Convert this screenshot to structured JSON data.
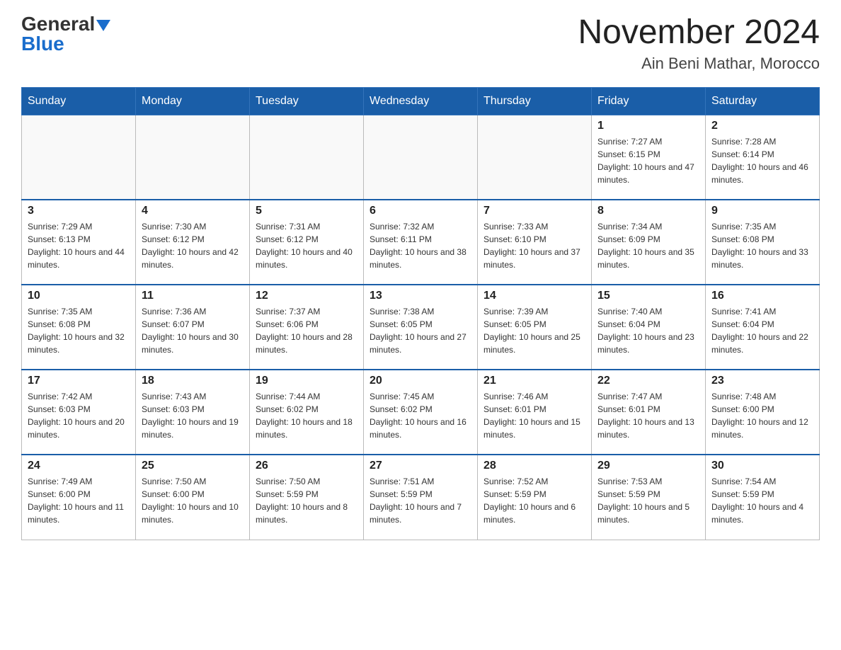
{
  "header": {
    "logo_general": "General",
    "logo_blue": "Blue",
    "title": "November 2024",
    "subtitle": "Ain Beni Mathar, Morocco"
  },
  "days_of_week": [
    "Sunday",
    "Monday",
    "Tuesday",
    "Wednesday",
    "Thursday",
    "Friday",
    "Saturday"
  ],
  "weeks": [
    [
      {
        "day": "",
        "sunrise": "",
        "sunset": "",
        "daylight": ""
      },
      {
        "day": "",
        "sunrise": "",
        "sunset": "",
        "daylight": ""
      },
      {
        "day": "",
        "sunrise": "",
        "sunset": "",
        "daylight": ""
      },
      {
        "day": "",
        "sunrise": "",
        "sunset": "",
        "daylight": ""
      },
      {
        "day": "",
        "sunrise": "",
        "sunset": "",
        "daylight": ""
      },
      {
        "day": "1",
        "sunrise": "Sunrise: 7:27 AM",
        "sunset": "Sunset: 6:15 PM",
        "daylight": "Daylight: 10 hours and 47 minutes."
      },
      {
        "day": "2",
        "sunrise": "Sunrise: 7:28 AM",
        "sunset": "Sunset: 6:14 PM",
        "daylight": "Daylight: 10 hours and 46 minutes."
      }
    ],
    [
      {
        "day": "3",
        "sunrise": "Sunrise: 7:29 AM",
        "sunset": "Sunset: 6:13 PM",
        "daylight": "Daylight: 10 hours and 44 minutes."
      },
      {
        "day": "4",
        "sunrise": "Sunrise: 7:30 AM",
        "sunset": "Sunset: 6:12 PM",
        "daylight": "Daylight: 10 hours and 42 minutes."
      },
      {
        "day": "5",
        "sunrise": "Sunrise: 7:31 AM",
        "sunset": "Sunset: 6:12 PM",
        "daylight": "Daylight: 10 hours and 40 minutes."
      },
      {
        "day": "6",
        "sunrise": "Sunrise: 7:32 AM",
        "sunset": "Sunset: 6:11 PM",
        "daylight": "Daylight: 10 hours and 38 minutes."
      },
      {
        "day": "7",
        "sunrise": "Sunrise: 7:33 AM",
        "sunset": "Sunset: 6:10 PM",
        "daylight": "Daylight: 10 hours and 37 minutes."
      },
      {
        "day": "8",
        "sunrise": "Sunrise: 7:34 AM",
        "sunset": "Sunset: 6:09 PM",
        "daylight": "Daylight: 10 hours and 35 minutes."
      },
      {
        "day": "9",
        "sunrise": "Sunrise: 7:35 AM",
        "sunset": "Sunset: 6:08 PM",
        "daylight": "Daylight: 10 hours and 33 minutes."
      }
    ],
    [
      {
        "day": "10",
        "sunrise": "Sunrise: 7:35 AM",
        "sunset": "Sunset: 6:08 PM",
        "daylight": "Daylight: 10 hours and 32 minutes."
      },
      {
        "day": "11",
        "sunrise": "Sunrise: 7:36 AM",
        "sunset": "Sunset: 6:07 PM",
        "daylight": "Daylight: 10 hours and 30 minutes."
      },
      {
        "day": "12",
        "sunrise": "Sunrise: 7:37 AM",
        "sunset": "Sunset: 6:06 PM",
        "daylight": "Daylight: 10 hours and 28 minutes."
      },
      {
        "day": "13",
        "sunrise": "Sunrise: 7:38 AM",
        "sunset": "Sunset: 6:05 PM",
        "daylight": "Daylight: 10 hours and 27 minutes."
      },
      {
        "day": "14",
        "sunrise": "Sunrise: 7:39 AM",
        "sunset": "Sunset: 6:05 PM",
        "daylight": "Daylight: 10 hours and 25 minutes."
      },
      {
        "day": "15",
        "sunrise": "Sunrise: 7:40 AM",
        "sunset": "Sunset: 6:04 PM",
        "daylight": "Daylight: 10 hours and 23 minutes."
      },
      {
        "day": "16",
        "sunrise": "Sunrise: 7:41 AM",
        "sunset": "Sunset: 6:04 PM",
        "daylight": "Daylight: 10 hours and 22 minutes."
      }
    ],
    [
      {
        "day": "17",
        "sunrise": "Sunrise: 7:42 AM",
        "sunset": "Sunset: 6:03 PM",
        "daylight": "Daylight: 10 hours and 20 minutes."
      },
      {
        "day": "18",
        "sunrise": "Sunrise: 7:43 AM",
        "sunset": "Sunset: 6:03 PM",
        "daylight": "Daylight: 10 hours and 19 minutes."
      },
      {
        "day": "19",
        "sunrise": "Sunrise: 7:44 AM",
        "sunset": "Sunset: 6:02 PM",
        "daylight": "Daylight: 10 hours and 18 minutes."
      },
      {
        "day": "20",
        "sunrise": "Sunrise: 7:45 AM",
        "sunset": "Sunset: 6:02 PM",
        "daylight": "Daylight: 10 hours and 16 minutes."
      },
      {
        "day": "21",
        "sunrise": "Sunrise: 7:46 AM",
        "sunset": "Sunset: 6:01 PM",
        "daylight": "Daylight: 10 hours and 15 minutes."
      },
      {
        "day": "22",
        "sunrise": "Sunrise: 7:47 AM",
        "sunset": "Sunset: 6:01 PM",
        "daylight": "Daylight: 10 hours and 13 minutes."
      },
      {
        "day": "23",
        "sunrise": "Sunrise: 7:48 AM",
        "sunset": "Sunset: 6:00 PM",
        "daylight": "Daylight: 10 hours and 12 minutes."
      }
    ],
    [
      {
        "day": "24",
        "sunrise": "Sunrise: 7:49 AM",
        "sunset": "Sunset: 6:00 PM",
        "daylight": "Daylight: 10 hours and 11 minutes."
      },
      {
        "day": "25",
        "sunrise": "Sunrise: 7:50 AM",
        "sunset": "Sunset: 6:00 PM",
        "daylight": "Daylight: 10 hours and 10 minutes."
      },
      {
        "day": "26",
        "sunrise": "Sunrise: 7:50 AM",
        "sunset": "Sunset: 5:59 PM",
        "daylight": "Daylight: 10 hours and 8 minutes."
      },
      {
        "day": "27",
        "sunrise": "Sunrise: 7:51 AM",
        "sunset": "Sunset: 5:59 PM",
        "daylight": "Daylight: 10 hours and 7 minutes."
      },
      {
        "day": "28",
        "sunrise": "Sunrise: 7:52 AM",
        "sunset": "Sunset: 5:59 PM",
        "daylight": "Daylight: 10 hours and 6 minutes."
      },
      {
        "day": "29",
        "sunrise": "Sunrise: 7:53 AM",
        "sunset": "Sunset: 5:59 PM",
        "daylight": "Daylight: 10 hours and 5 minutes."
      },
      {
        "day": "30",
        "sunrise": "Sunrise: 7:54 AM",
        "sunset": "Sunset: 5:59 PM",
        "daylight": "Daylight: 10 hours and 4 minutes."
      }
    ]
  ]
}
